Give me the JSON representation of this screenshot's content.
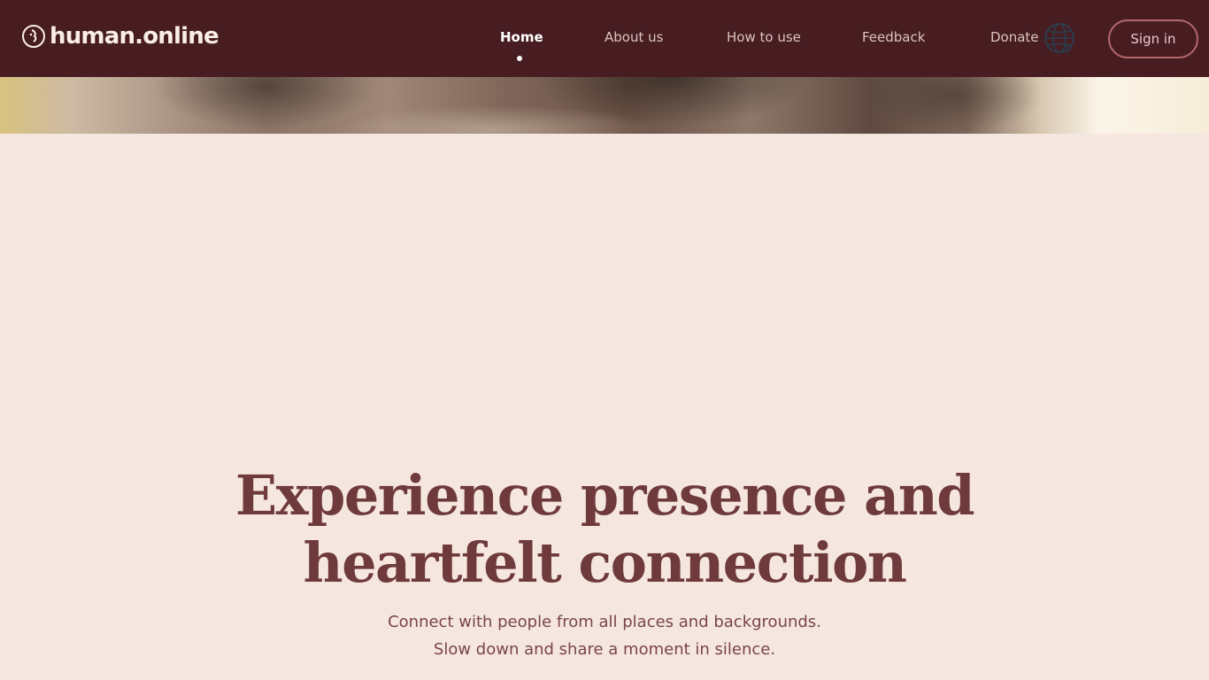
{
  "brand": {
    "name": "human.online"
  },
  "nav": {
    "items": [
      {
        "label": "Home",
        "active": true
      },
      {
        "label": "About us",
        "active": false
      },
      {
        "label": "How to use",
        "active": false
      },
      {
        "label": "Feedback",
        "active": false
      },
      {
        "label": "Donate",
        "active": false
      }
    ],
    "sign_in": "Sign in",
    "language_icon": "globe-icon"
  },
  "hero": {
    "headline_line1": "Experience presence and",
    "headline_line2": "heartfelt connection",
    "subtitle_line1": "Connect with people from all places and backgrounds.",
    "subtitle_line2": "Slow down and share a moment in silence."
  },
  "colors": {
    "navbar_bg": "#471d22",
    "page_bg": "#f5e7df",
    "headline": "#6f3a3c",
    "accent_border": "#b5686d"
  }
}
